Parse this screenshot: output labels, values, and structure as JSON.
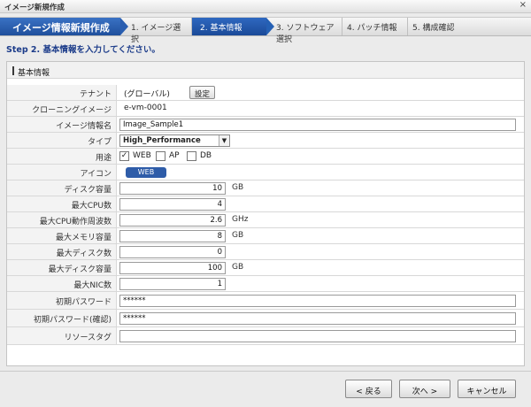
{
  "window": {
    "title": "イメージ新規作成",
    "close": "×"
  },
  "wizard": {
    "title": "イメージ情報新規作成",
    "steps": [
      "1. イメージ選択",
      "2. 基本情報",
      "3. ソフトウェア選択",
      "4. パッチ情報",
      "5. 構成確認"
    ],
    "active_step": 2
  },
  "step_heading": "Step 2. 基本情報を入力してください。",
  "panel": {
    "title": "基本情報",
    "tenant": {
      "label": "テナント",
      "value": "(グローバル)",
      "button": "設定"
    },
    "cloning_image": {
      "label": "クローニングイメージ",
      "value": "e-vm-0001"
    },
    "image_name": {
      "label": "イメージ情報名",
      "value": "Image_Sample1"
    },
    "type": {
      "label": "タイプ",
      "selected": "High_Performance"
    },
    "usage": {
      "label": "用途",
      "options": [
        {
          "name": "WEB",
          "checked": true
        },
        {
          "name": "AP",
          "checked": false
        },
        {
          "name": "DB",
          "checked": false
        }
      ]
    },
    "icon": {
      "label": "アイコン",
      "value": "WEB"
    },
    "disk_capacity": {
      "label": "ディスク容量",
      "value": "10",
      "unit": "GB"
    },
    "max_cpu": {
      "label": "最大CPU数",
      "value": "4"
    },
    "max_cpu_freq": {
      "label": "最大CPU動作周波数",
      "value": "2.6",
      "unit": "GHz"
    },
    "max_memory": {
      "label": "最大メモリ容量",
      "value": "8",
      "unit": "GB"
    },
    "max_disks": {
      "label": "最大ディスク数",
      "value": "0"
    },
    "max_disk_capacity": {
      "label": "最大ディスク容量",
      "value": "100",
      "unit": "GB"
    },
    "max_nic": {
      "label": "最大NIC数",
      "value": "1"
    },
    "init_password": {
      "label": "初期パスワード",
      "value": "******"
    },
    "init_password_confirm": {
      "label": "初期パスワード(確認)",
      "value": "******"
    },
    "resource_tag": {
      "label": "リソースタグ",
      "value": ""
    }
  },
  "footer": {
    "back": "< 戻る",
    "next": "次へ >",
    "cancel": "キャンセル"
  },
  "colors": {
    "accent": "#2a5eb0",
    "heading": "#1c3c8a"
  }
}
